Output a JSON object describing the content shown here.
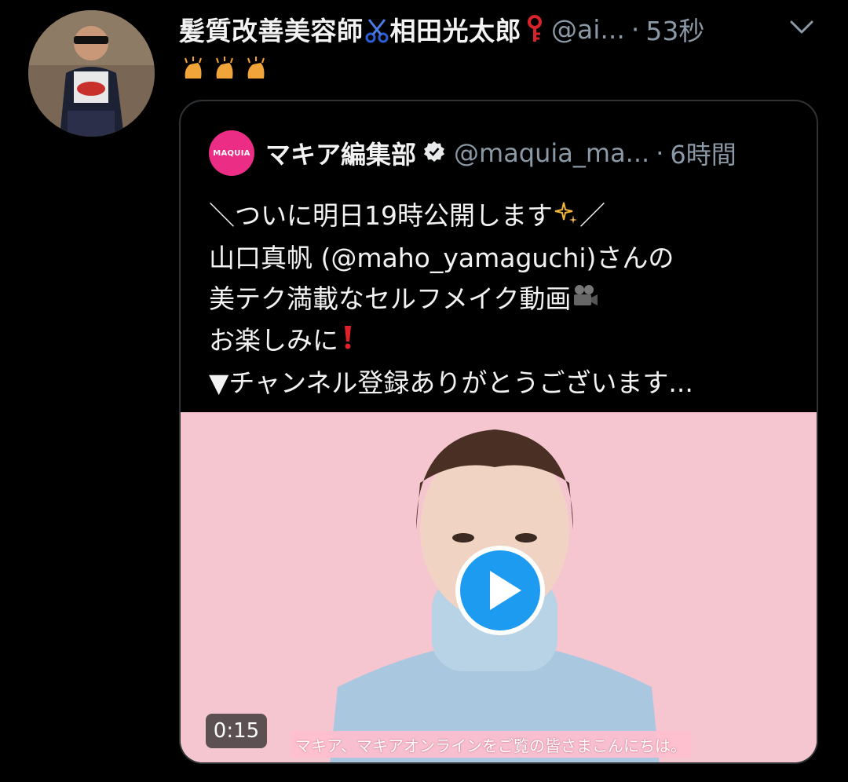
{
  "tweet": {
    "author_name_part1": "髪質改善美容師",
    "author_name_part2": "相田光太郎",
    "handle": "@ai...",
    "separator": "·",
    "time": "53秒",
    "emojis": [
      "scissors-emoji",
      "key-emoji",
      "clapping-hands-emoji"
    ]
  },
  "quote": {
    "logo_text": "MAQUIA",
    "author_name": "マキア編集部",
    "handle": "@maquia_ma...",
    "separator": "·",
    "time": "6時間",
    "text_lines": [
      "＼ついに明日19時公開します",
      "／",
      "山口真帆 (@maho_yamaguchi)さんの",
      "美テク満載なセルフメイク動画",
      "お楽しみに",
      "▼チャンネル登録ありがとうございます..."
    ],
    "video": {
      "duration": "0:15",
      "subtitle": "マキア、マキアオンラインをご覧の皆さまこんにちは。"
    }
  },
  "colors": {
    "background": "#000000",
    "secondary_text": "#8b98a5",
    "card_border": "#2f3336",
    "brand_pink": "#ec2d86",
    "play_blue": "#1d9bf0"
  },
  "icons": [
    "chevron-down-icon",
    "verified-badge-icon",
    "play-icon",
    "sparkles-emoji",
    "movie-camera-emoji",
    "exclamation-emoji"
  ]
}
